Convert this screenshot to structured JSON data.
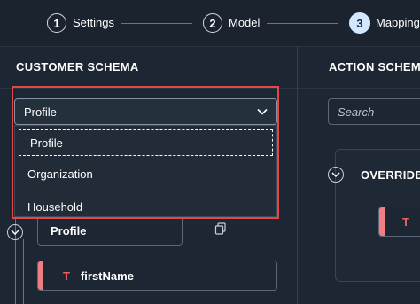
{
  "stepper": {
    "steps": [
      {
        "number": "1",
        "label": "Settings"
      },
      {
        "number": "2",
        "label": "Model"
      },
      {
        "number": "3",
        "label": "Mappings"
      }
    ]
  },
  "customer_schema": {
    "header": "CUSTOMER SCHEMA",
    "dropdown": {
      "selected": "Profile",
      "options": [
        "Profile",
        "Organization",
        "Household"
      ]
    },
    "tree": {
      "root_label": "Profile",
      "fields": [
        {
          "type_icon": "T",
          "label": "firstName"
        }
      ]
    }
  },
  "action_schema": {
    "header": "ACTION SCHEMA",
    "search_placeholder": "Search",
    "override_label": "OVERRIDES",
    "field_type_icon": "T"
  },
  "colors": {
    "background": "#1d2633",
    "highlight_border": "#e2474a",
    "active_step": "#d1e8ff",
    "field_accent": "#ee7f84"
  }
}
